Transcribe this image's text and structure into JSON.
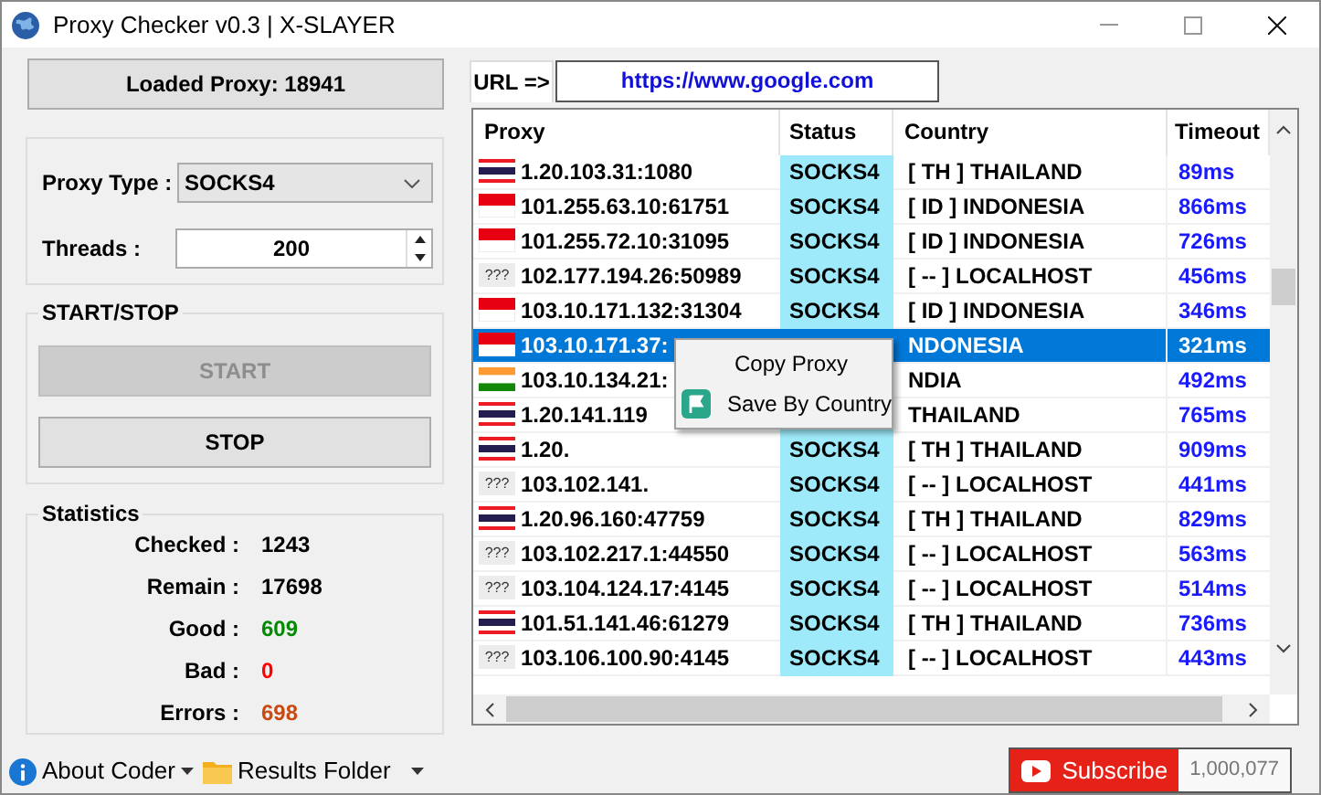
{
  "window": {
    "title": "Proxy Checker v0.3 | X-SLAYER"
  },
  "loaded_proxy_button": "Loaded Proxy: 18941",
  "settings": {
    "proxy_type_label": "Proxy Type :",
    "proxy_type": "SOCKS4",
    "threads_label": "Threads :",
    "threads": "200"
  },
  "start_stop": {
    "title": "START/STOP",
    "buttons": [
      {
        "label": "START",
        "disabled": true
      },
      {
        "label": "STOP",
        "disabled": false
      }
    ]
  },
  "statistics": {
    "title": "Statistics",
    "items": [
      {
        "label": "Checked :",
        "value": "1243",
        "color": "#000000"
      },
      {
        "label": "Remain :",
        "value": "17698",
        "color": "#000000"
      },
      {
        "label": "Good :",
        "value": "609",
        "color": "#008a00"
      },
      {
        "label": "Bad :",
        "value": "0",
        "color": "#ff0000"
      },
      {
        "label": "Errors :",
        "value": "698",
        "color": "#c84a10"
      }
    ]
  },
  "url": {
    "label": "URL =>",
    "value": "https://www.google.com"
  },
  "table": {
    "columns": [
      "Proxy",
      "Status",
      "Country",
      "Timeout"
    ],
    "rows": [
      {
        "kind": "th",
        "proxy": "1.20.103.31:1080",
        "status": "SOCKS4",
        "country": "[ TH ] THAILAND",
        "timeout": "89ms",
        "selected": false
      },
      {
        "kind": "id",
        "proxy": "101.255.63.10:61751",
        "status": "SOCKS4",
        "country": "[ ID ] INDONESIA",
        "timeout": "866ms",
        "selected": false
      },
      {
        "kind": "id",
        "proxy": "101.255.72.10:31095",
        "status": "SOCKS4",
        "country": "[ ID ] INDONESIA",
        "timeout": "726ms",
        "selected": false
      },
      {
        "kind": "unknown",
        "flag_label": "???",
        "proxy": "102.177.194.26:50989",
        "status": "SOCKS4",
        "country": "[ -- ] LOCALHOST",
        "timeout": "456ms",
        "selected": false
      },
      {
        "kind": "id",
        "proxy": "103.10.171.132:31304",
        "status": "SOCKS4",
        "country": "[ ID ] INDONESIA",
        "timeout": "346ms",
        "selected": false
      },
      {
        "kind": "id",
        "proxy": "103.10.171.37:",
        "country": "NDONESIA",
        "timeout": "321ms",
        "selected": true
      },
      {
        "kind": "in",
        "proxy": "103.10.134.21:",
        "country": "NDIA",
        "timeout": "492ms",
        "selected": false
      },
      {
        "kind": "th",
        "proxy": "1.20.141.119",
        "country": "THAILAND",
        "timeout": "765ms",
        "selected": false
      },
      {
        "kind": "th",
        "proxy": "1.20.",
        "status": "SOCKS4",
        "country": "[ TH ] THAILAND",
        "timeout": "909ms",
        "selected": false
      },
      {
        "kind": "unknown",
        "flag_label": "???",
        "proxy": "103.102.141.",
        "status": "SOCKS4",
        "country": "[ -- ] LOCALHOST",
        "timeout": "441ms",
        "selected": false
      },
      {
        "kind": "th",
        "proxy": "1.20.96.160:47759",
        "status": "SOCKS4",
        "country": "[ TH ] THAILAND",
        "timeout": "829ms",
        "selected": false
      },
      {
        "kind": "unknown",
        "flag_label": "???",
        "proxy": "103.102.217.1:44550",
        "status": "SOCKS4",
        "country": "[ -- ] LOCALHOST",
        "timeout": "563ms",
        "selected": false
      },
      {
        "kind": "unknown",
        "flag_label": "???",
        "proxy": "103.104.124.17:4145",
        "status": "SOCKS4",
        "country": "[ -- ] LOCALHOST",
        "timeout": "514ms",
        "selected": false
      },
      {
        "kind": "th",
        "proxy": "101.51.141.46:61279",
        "status": "SOCKS4",
        "country": "[ TH ] THAILAND",
        "timeout": "736ms",
        "selected": false
      },
      {
        "kind": "unknown",
        "flag_label": "???",
        "proxy": "103.106.100.90:4145",
        "status": "SOCKS4",
        "country": "[ -- ] LOCALHOST",
        "timeout": "443ms",
        "selected": false
      }
    ]
  },
  "context_menu": {
    "items": [
      {
        "label": "Copy Proxy",
        "kind": "plain"
      },
      {
        "label": "Save By Country",
        "kind": "flag"
      }
    ]
  },
  "footer": {
    "about": "About Coder",
    "results": "Results Folder"
  },
  "subscribe": {
    "label": "Subscribe",
    "count": "1,000,077"
  }
}
